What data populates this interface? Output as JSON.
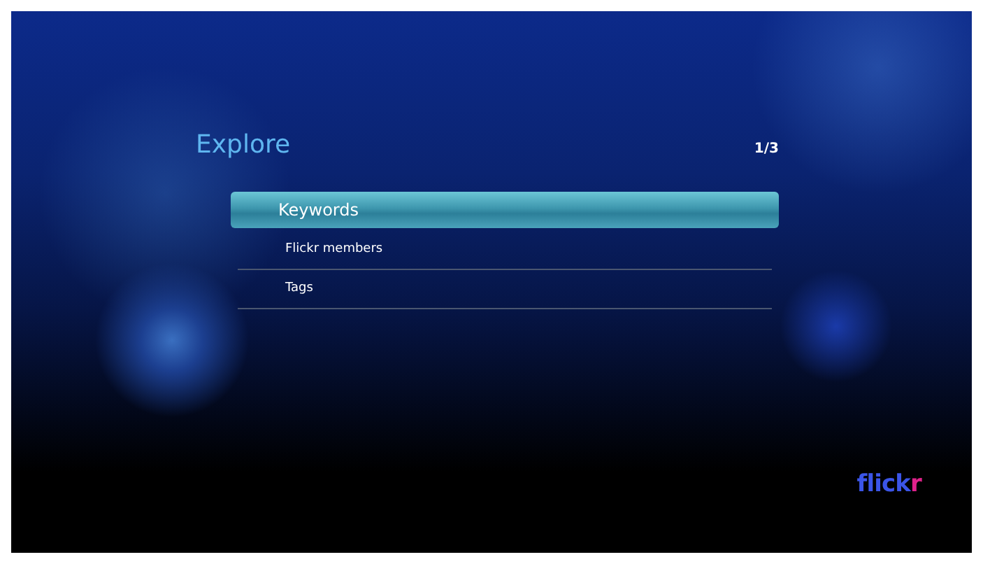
{
  "title": "Explore",
  "page": "1/3",
  "menu": [
    {
      "label": "Keywords",
      "selected": true
    },
    {
      "label": "Flickr members",
      "selected": false
    },
    {
      "label": "Tags",
      "selected": false
    }
  ],
  "logo": {
    "main": "flick",
    "accent": "r"
  }
}
